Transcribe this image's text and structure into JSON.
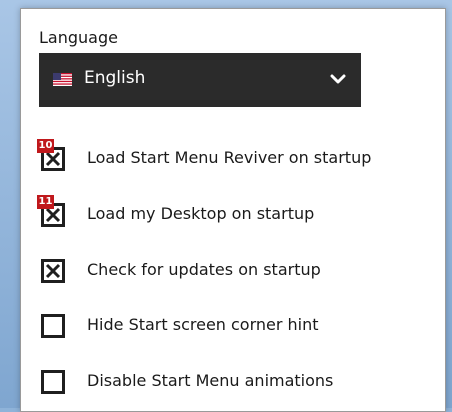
{
  "language": {
    "label": "Language",
    "selected": "English",
    "flag_icon": "us-flag-icon"
  },
  "options": [
    {
      "label": "Load Start Menu Reviver on startup",
      "checked": true,
      "badge": "10"
    },
    {
      "label": "Load my Desktop on startup",
      "checked": true,
      "badge": "11"
    },
    {
      "label": "Check for updates on startup",
      "checked": true,
      "badge": ""
    },
    {
      "label": "Hide Start screen corner hint",
      "checked": false,
      "badge": ""
    },
    {
      "label": "Disable Start Menu animations",
      "checked": false,
      "badge": ""
    }
  ],
  "colors": {
    "dropdown_bg": "#2b2b2b",
    "badge_bg": "#c0181c",
    "checkbox_border": "#1f1f1f"
  }
}
